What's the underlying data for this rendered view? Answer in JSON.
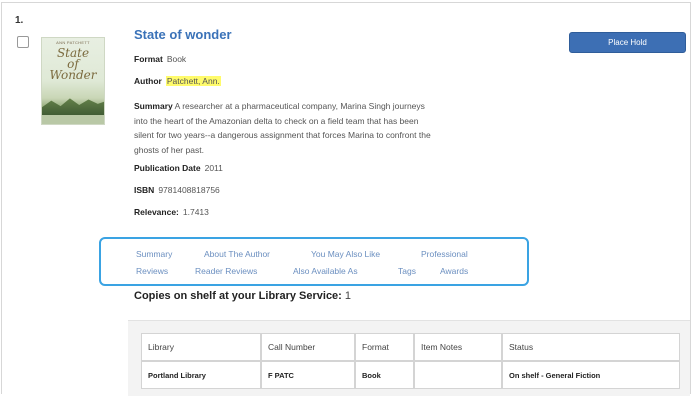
{
  "result": {
    "number": "1.",
    "cover": {
      "author": "ANN PATCHETT",
      "title_line1": "State",
      "title_line2": "of",
      "title_line3": "Wonder"
    },
    "title": "State of wonder",
    "place_hold_label": "Place Hold",
    "format_label": "Format",
    "format_value": "Book",
    "author_label": "Author",
    "author_value": "Patchett, Ann.",
    "summary_label": "Summary",
    "summary_lines": [
      "A researcher at a pharmaceutical company, Marina Singh journeys",
      "into the heart of the Amazonian delta to check on a field team that has been",
      "silent for two years--a dangerous assignment that forces Marina to confront the",
      "ghosts of her past."
    ],
    "pubdate_label": "Publication Date",
    "pubdate_value": "2011",
    "isbn_label": "ISBN",
    "isbn_value": "9781408818756",
    "relevance_label": "Relevance:",
    "relevance_value": "1.7413"
  },
  "tabs": {
    "summary": "Summary",
    "about_author": "About The Author",
    "you_may_also_like": "You May Also Like",
    "professional": "Professional",
    "reviews": "Reviews",
    "reader_reviews": "Reader Reviews",
    "also_available_as": "Also Available As",
    "tags": "Tags",
    "awards": "Awards"
  },
  "copies": {
    "label": "Copies on shelf at your Library Service:",
    "count": "1"
  },
  "holdings": {
    "headers": [
      "Library",
      "Call Number",
      "Format",
      "Item Notes",
      "Status"
    ],
    "rows": [
      [
        "Portland Library",
        "F PATC",
        "Book",
        "",
        "On shelf - General Fiction"
      ]
    ]
  },
  "colors": {
    "title": "#3a72b8",
    "button": "#3d6fb4",
    "tab_box": "#3aa3e3",
    "highlight": "#fffb6b"
  }
}
